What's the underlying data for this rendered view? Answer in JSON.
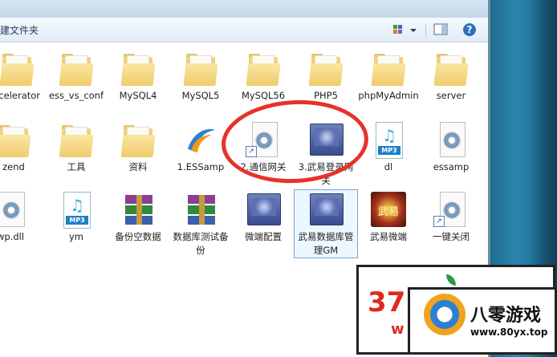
{
  "toolbar": {
    "new_folder_label": "建文件夹"
  },
  "items": [
    {
      "label": "ccelerator",
      "icon": "folder-icon"
    },
    {
      "label": "ess_vs_conf",
      "icon": "folder-icon"
    },
    {
      "label": "MySQL4",
      "icon": "folder-icon"
    },
    {
      "label": "MySQL5",
      "icon": "folder-icon"
    },
    {
      "label": "MySQL56",
      "icon": "folder-icon"
    },
    {
      "label": "PHP5",
      "icon": "folder-icon"
    },
    {
      "label": "phpMyAdmin",
      "icon": "folder-icon"
    },
    {
      "label": "server",
      "icon": "folder-icon"
    },
    {
      "label": "zend",
      "icon": "folder-icon"
    },
    {
      "label": "工具",
      "icon": "folder-icon"
    },
    {
      "label": "资料",
      "icon": "folder-icon"
    },
    {
      "label": "1.ESSamp",
      "icon": "app-swoosh-icon"
    },
    {
      "label": "2.通信网关",
      "icon": "config-shortcut-icon"
    },
    {
      "label": "3.武易登录网关",
      "icon": "monitor-app-icon"
    },
    {
      "label": "dl",
      "icon": "mp3-file-icon",
      "tag": "MP3"
    },
    {
      "label": "essamp",
      "icon": "config-file-icon"
    },
    {
      "label": "wp.dll",
      "icon": "config-file-icon"
    },
    {
      "label": "ym",
      "icon": "mp3-file-icon",
      "tag": "MP3"
    },
    {
      "label": "备份空数据",
      "icon": "rar-archive-icon"
    },
    {
      "label": "数据库测试备份",
      "icon": "rar-archive-icon"
    },
    {
      "label": "微端配置",
      "icon": "monitor-app-icon"
    },
    {
      "label": "武易数据库管理GM",
      "icon": "monitor-app-icon"
    },
    {
      "label": "武易微端",
      "icon": "game-app-icon",
      "glyph": "武易"
    },
    {
      "label": "一键关闭",
      "icon": "config-shortcut-icon"
    }
  ],
  "watermark": {
    "left_number": "37",
    "left_sub": "w",
    "brand_name": "八零游戏",
    "brand_url": "www.80yx.top"
  },
  "colors": {
    "highlight_circle": "#e8312a",
    "folder": "#efcc6b",
    "selection_outline": "#7da2ce"
  }
}
